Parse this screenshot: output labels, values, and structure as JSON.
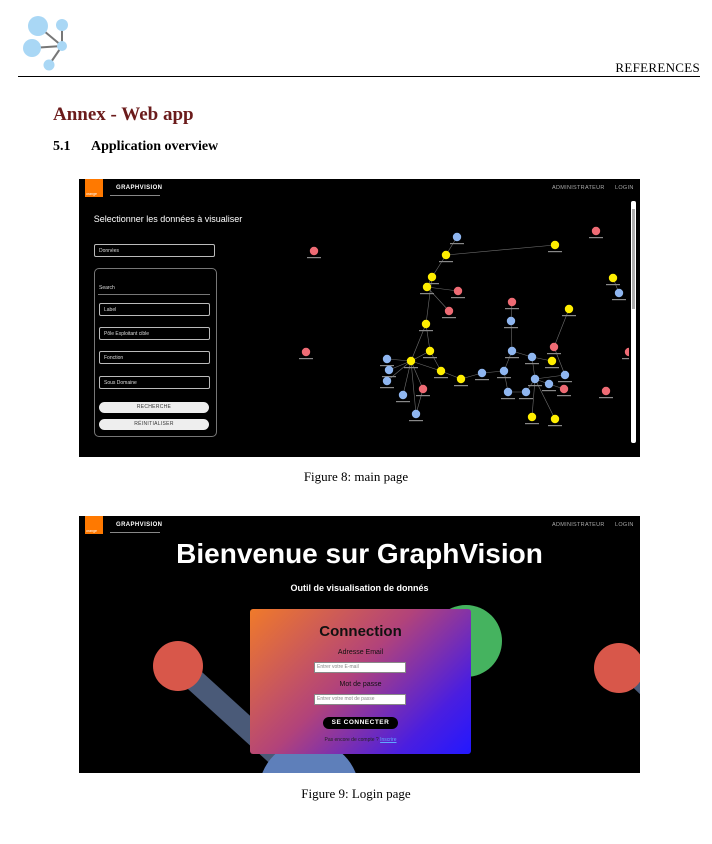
{
  "header": {
    "running_title": "REFERENCES"
  },
  "annex": {
    "title": "Annex - Web app"
  },
  "section": {
    "number": "5.1",
    "title": "Application overview"
  },
  "figures": [
    {
      "caption": "Figure 8: main page",
      "nav": {
        "brand": "GRAPHVISION",
        "admin": "ADMINISTRATEUR",
        "login": "LOGIN",
        "logo_text": "orange"
      },
      "panel": {
        "title": "Selectionner les données à visualiser",
        "dataset_select": "Données",
        "search_label": "Search",
        "fields": [
          "Label",
          "Pôle Exploitant cible",
          "Fonction",
          "Sous Domaine"
        ],
        "search_button": "RECHERCHE",
        "reset_button": "RÉINITIALISER"
      },
      "graph_colors": {
        "yellow": "#ffee00",
        "blue": "#8fb6f0",
        "red": "#ee6b74",
        "edge": "#6f6f6f"
      }
    },
    {
      "caption": "Figure 9: Login page",
      "nav": {
        "brand": "GRAPHVISION",
        "admin": "ADMINISTRATEUR",
        "login": "LOGIN",
        "logo_text": "orange"
      },
      "welcome": "Bienvenue sur GraphVision",
      "subtitle": "Outil de visualisation de donnés",
      "card": {
        "title": "Connection",
        "email_label": "Adresse Email",
        "email_placeholder": "Entrer votre E-mail",
        "password_label": "Mot de passe",
        "password_placeholder": "Entrer votre mot de passe",
        "submit": "SE CONNECTER",
        "footer_text": "Pas encore de compte ?",
        "footer_link": "Inscrire"
      }
    }
  ]
}
